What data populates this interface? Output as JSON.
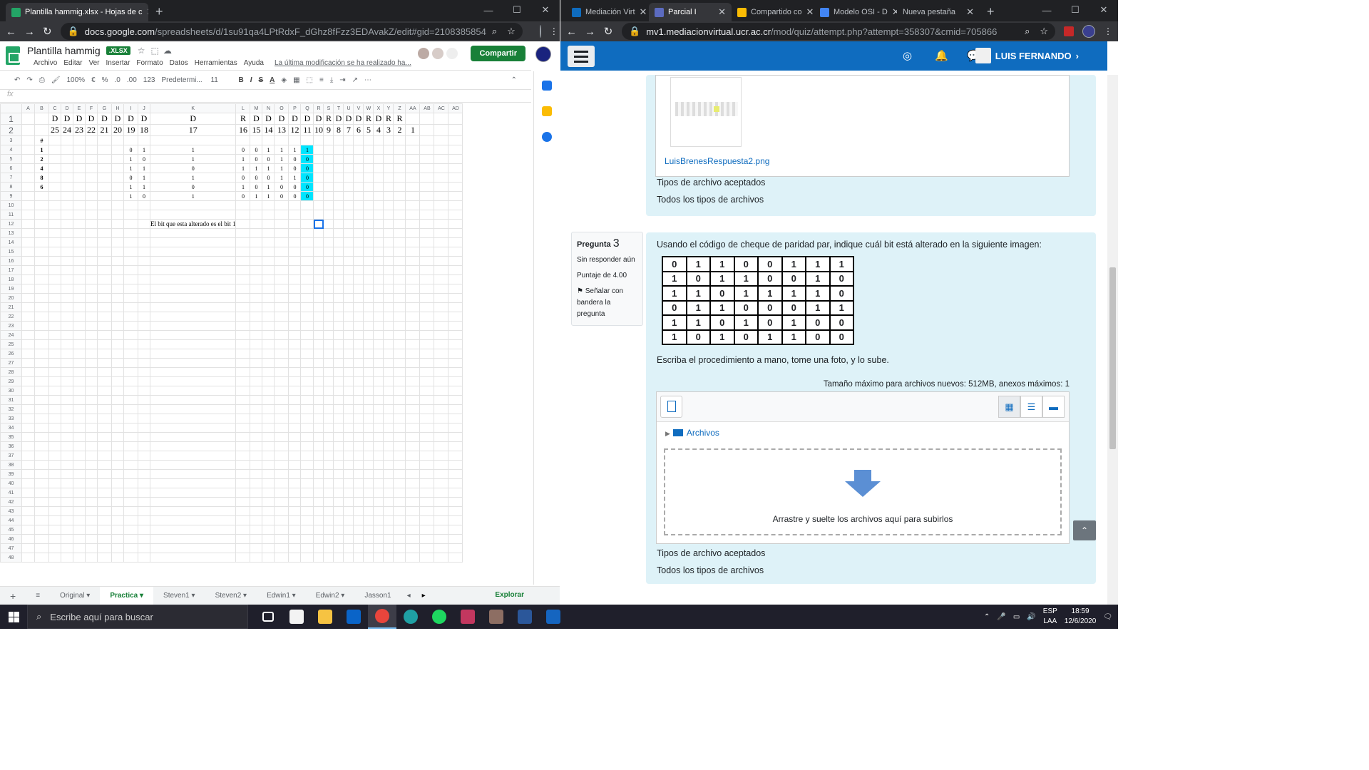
{
  "left_browser": {
    "tab_title": "Plantilla hammig.xlsx - Hojas de c",
    "url_host": "docs.google.com",
    "url_path": "/spreadsheets/d/1su91qa4LPtRdxF_dGhz8fFzz3EDAvakZ/edit#gid=2108385854"
  },
  "sheets": {
    "doc_title": "Plantilla hammig",
    "badge": ".XLSX",
    "menu": [
      "Archivo",
      "Editar",
      "Ver",
      "Insertar",
      "Formato",
      "Datos",
      "Herramientas",
      "Ayuda"
    ],
    "last_edit": "La última modificación se ha realizado ha...",
    "share_label": "Compartir",
    "toolbar": {
      "zoom": "100%",
      "currency": "€",
      "percent": "%",
      "dec_less": ".0",
      "dec_more": ".00",
      "format": "123",
      "font": "Predetermi...",
      "size": "11"
    },
    "fx": "fx",
    "col_headers": [
      "A",
      "B",
      "C",
      "D",
      "E",
      "F",
      "G",
      "H",
      "I",
      "J",
      "K",
      "L",
      "M",
      "N",
      "O",
      "P",
      "Q",
      "R",
      "S",
      "T",
      "U",
      "V",
      "W",
      "X",
      "Y",
      "Z",
      "AA",
      "AB",
      "AC",
      "AD"
    ],
    "row1": [
      "",
      "D",
      "D",
      "D",
      "D",
      "D",
      "D",
      "D",
      "D",
      "D",
      "R",
      "D",
      "D",
      "D",
      "D",
      "D",
      "D",
      "R",
      "D",
      "D",
      "D",
      "R",
      "D",
      "R",
      "R",
      "",
      "",
      "",
      ""
    ],
    "row2": [
      "",
      "25",
      "24",
      "23",
      "22",
      "21",
      "20",
      "19",
      "18",
      "17",
      "16",
      "15",
      "14",
      "13",
      "12",
      "11",
      "10",
      "9",
      "8",
      "7",
      "6",
      "5",
      "4",
      "3",
      "2",
      "1",
      "",
      "",
      ""
    ],
    "row3_a": "#",
    "data_rows": [
      {
        "a": "1",
        "bits": [
          "0",
          "1",
          "1",
          "0",
          "0",
          "1",
          "1",
          "1",
          "1"
        ]
      },
      {
        "a": "2",
        "bits": [
          "1",
          "0",
          "1",
          "1",
          "0",
          "0",
          "1",
          "0",
          "0"
        ]
      },
      {
        "a": "4",
        "bits": [
          "1",
          "1",
          "0",
          "1",
          "1",
          "1",
          "1",
          "0",
          "0"
        ]
      },
      {
        "a": "8",
        "bits": [
          "0",
          "1",
          "1",
          "0",
          "0",
          "0",
          "1",
          "1",
          "0"
        ]
      },
      {
        "a": "6",
        "bits": [
          "1",
          "1",
          "0",
          "1",
          "0",
          "1",
          "0",
          "0",
          "0"
        ]
      },
      {
        "a": "",
        "bits": [
          "1",
          "0",
          "1",
          "0",
          "1",
          "1",
          "0",
          "0",
          "0"
        ]
      }
    ],
    "note": "El bit que esta alterado es el bit 1",
    "sheet_tabs": [
      "Original",
      "Practica",
      "Steven1",
      "Steven2",
      "Edwin1",
      "Edwin2",
      "Jasson1"
    ],
    "active_sheet": "Practica",
    "explore_label": "Explorar"
  },
  "right_browser": {
    "tabs": [
      "Mediación Virt",
      "Parcial I",
      "Compartido co",
      "Modelo OSI - D",
      "Nueva pestaña"
    ],
    "url_host": "mv1.mediacionvirtual.ucr.ac.cr",
    "url_path": "/mod/quiz/attempt.php?attempt=358307&cmid=705866"
  },
  "moodle": {
    "user": "LUIS FERNANDO",
    "q2": {
      "file_name": "LuisBrenesRespuesta2.png",
      "accepted_label": "Tipos de archivo aceptados",
      "accepted_value": "Todos los tipos de archivos"
    },
    "q3": {
      "label": "Pregunta",
      "number": "3",
      "status": "Sin responder aún",
      "score": "Puntaje de 4.00",
      "flag": "Señalar con bandera la pregunta",
      "prompt": "Usando el código de cheque de paridad par, indique cuál bit está alterado en la siguiente imagen:",
      "matrix": [
        [
          "0",
          "1",
          "1",
          "0",
          "0",
          "1",
          "1",
          "1"
        ],
        [
          "1",
          "0",
          "1",
          "1",
          "0",
          "0",
          "1",
          "0"
        ],
        [
          "1",
          "1",
          "0",
          "1",
          "1",
          "1",
          "1",
          "0"
        ],
        [
          "0",
          "1",
          "1",
          "0",
          "0",
          "0",
          "1",
          "1"
        ],
        [
          "1",
          "1",
          "0",
          "1",
          "0",
          "1",
          "0",
          "0"
        ],
        [
          "1",
          "0",
          "1",
          "0",
          "1",
          "1",
          "0",
          "0"
        ]
      ],
      "instruction": "Escriba el procedimiento a mano, tome una foto, y lo sube.",
      "max_size": "Tamaño máximo para archivos nuevos: 512MB, anexos máximos: 1",
      "folder": "Archivos",
      "drop_text": "Arrastre y suelte los archivos aquí para subirlos",
      "accepted_label": "Tipos de archivo aceptados",
      "accepted_value": "Todos los tipos de archivos"
    }
  },
  "taskbar": {
    "search_placeholder": "Escribe aquí para buscar",
    "lang1": "ESP",
    "lang2": "LAA",
    "time": "18:59",
    "date": "12/6/2020"
  }
}
